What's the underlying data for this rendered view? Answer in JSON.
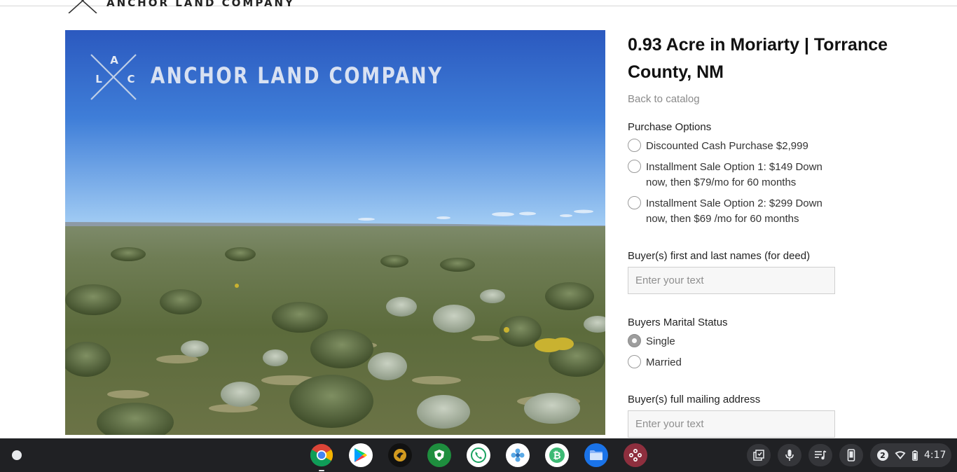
{
  "header": {
    "brand_name": "ANCHOR LAND COMPANY"
  },
  "hero": {
    "brand_text": "ANCHOR LAND COMPANY",
    "logo_letters": {
      "top": "A",
      "left": "L",
      "right": "C"
    }
  },
  "product": {
    "title": "0.93 Acre in Moriarty | Torrance County, NM",
    "back_link": "Back to catalog",
    "purchase_options_label": "Purchase Options",
    "purchase_options": [
      {
        "label": "Discounted Cash Purchase $2,999",
        "selected": false
      },
      {
        "label": "Installment Sale Option 1: $149 Down now, then $79/mo for 60 months",
        "selected": false
      },
      {
        "label": "Installment Sale Option 2: $299 Down now, then $69 /mo for 60 months",
        "selected": false
      }
    ],
    "names_label": "Buyer(s) first and last names (for deed)",
    "names_placeholder": "Enter your text",
    "names_value": "",
    "marital_label": "Buyers Marital Status",
    "marital_options": [
      {
        "label": "Single",
        "selected": true
      },
      {
        "label": "Married",
        "selected": false
      }
    ],
    "address_label": "Buyer(s) full mailing address",
    "address_placeholder": "Enter your text",
    "address_value": ""
  },
  "shelf": {
    "apps": [
      "chrome-icon",
      "play-store-icon",
      "bird-app-icon",
      "shield-turtle-icon",
      "phone-icon",
      "gear-flower-icon",
      "bitcoin-icon",
      "files-icon",
      "gamepad-icon"
    ],
    "tray": [
      "screen-capture-icon",
      "microphone-icon",
      "playlist-icon",
      "phone-hub-icon"
    ],
    "notification_count": "2",
    "time": "4:17"
  },
  "colors": {
    "shelf_bg": "#202124",
    "sky_top": "#2d5fc4",
    "sky_bottom": "#8ec1f4",
    "grass": "#5a6b3a"
  }
}
